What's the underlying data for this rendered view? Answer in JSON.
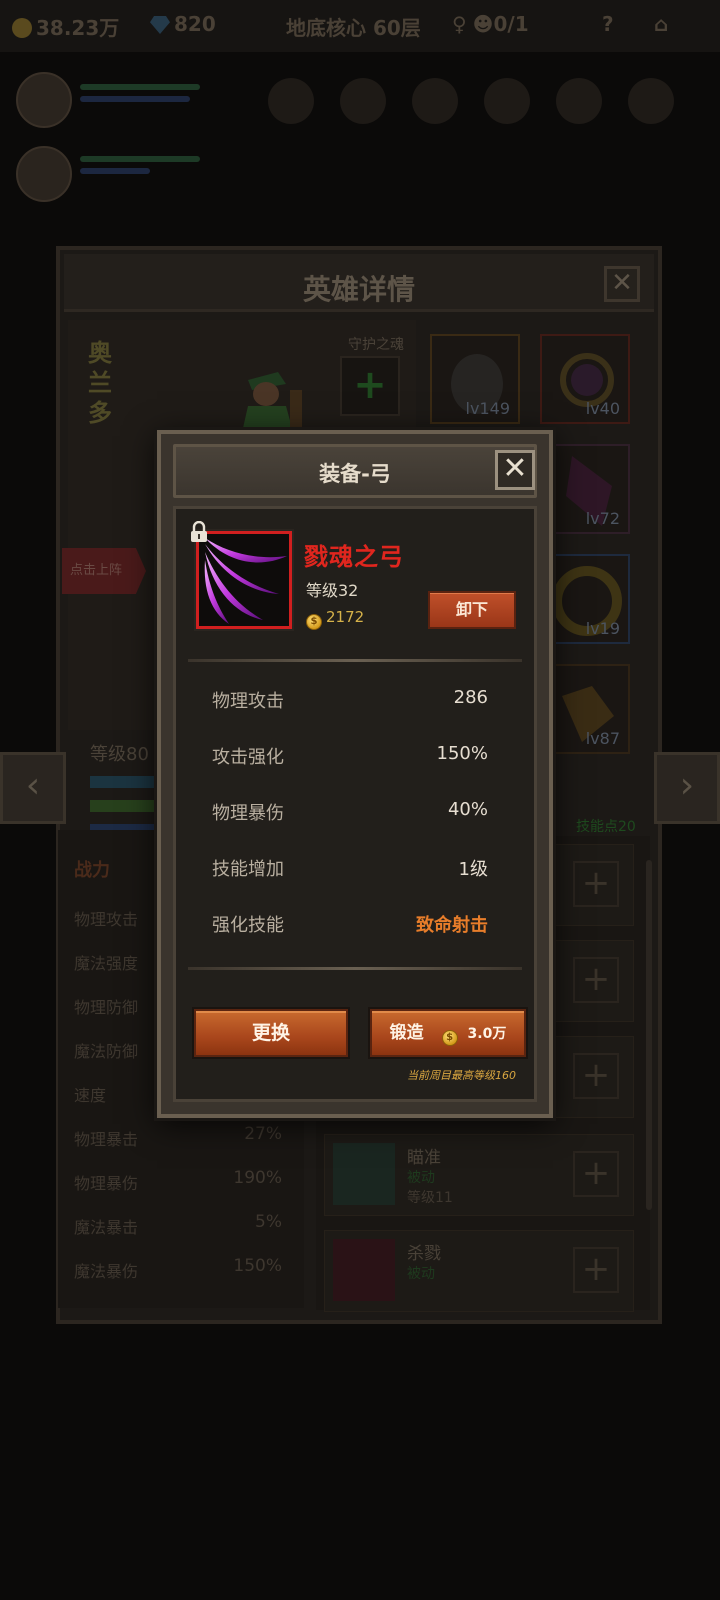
{
  "topbar": {
    "gold": "38.23万",
    "gems": "820",
    "stage": "地底核心 60层",
    "keys": "0/1"
  },
  "hero_panel": {
    "title": "英雄详情",
    "close": "✕",
    "hero_name": "奥兰多",
    "guard_soul_label": "守护之魂",
    "guard_add": "+",
    "deploy_tag": "点击上阵",
    "level": "等级80",
    "equipment_levels": [
      "lv149",
      "lv40",
      "lv72",
      "lv19",
      "lv87"
    ],
    "nav_prev": "‹",
    "nav_next": "›",
    "skill_points": "技能点20",
    "power_label": "战力",
    "stats": [
      {
        "label": "物理攻击",
        "value": ""
      },
      {
        "label": "魔法强度",
        "value": ""
      },
      {
        "label": "物理防御",
        "value": ""
      },
      {
        "label": "魔法防御",
        "value": ""
      },
      {
        "label": "速度",
        "value": ""
      },
      {
        "label": "物理暴击",
        "value": "27%"
      },
      {
        "label": "物理暴伤",
        "value": "190%"
      },
      {
        "label": "魔法暴击",
        "value": "5%"
      },
      {
        "label": "魔法暴伤",
        "value": "150%"
      }
    ],
    "skills": [
      {
        "name": "瞄准",
        "type": "被动",
        "level": "等级11"
      },
      {
        "name": "杀戮",
        "type": "被动",
        "level": ""
      }
    ]
  },
  "modal": {
    "title": "装备-弓",
    "close": "✕",
    "item_name": "戮魂之弓",
    "item_level": "等级32",
    "item_price": "2172",
    "unequip_label": "卸下",
    "attributes": [
      {
        "label": "物理攻击",
        "value": "286"
      },
      {
        "label": "攻击强化",
        "value": "150%"
      },
      {
        "label": "物理暴伤",
        "value": "40%"
      },
      {
        "label": "技能增加",
        "value": "1级"
      },
      {
        "label": "强化技能",
        "value": "致命射击"
      }
    ],
    "replace_label": "更换",
    "forge_label": "锻造",
    "forge_cost": "3.0万",
    "forge_note": "当前周目最高等级160"
  },
  "colors": {
    "item_name": "#e0261e",
    "button_orange": "#b0491d",
    "highlight_skill": "#e87d2a",
    "rarity_border": "#d01f1f"
  },
  "icons": {
    "gold": "coin-icon",
    "gems": "gem-icon",
    "keys": "key-icon",
    "lock": "lock-icon",
    "item": "purple-bow-icon"
  }
}
